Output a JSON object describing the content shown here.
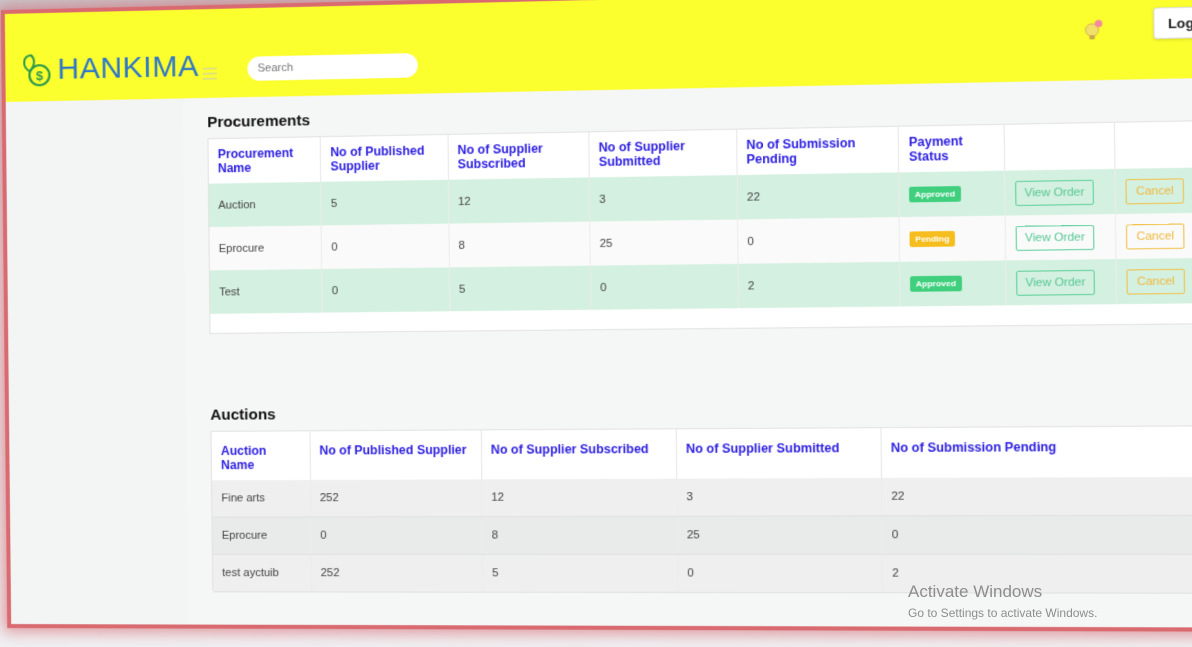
{
  "header": {
    "logo_text": "HANKIMA",
    "search_placeholder": "Search",
    "logout_label": "Log out"
  },
  "procurements": {
    "title": "Procurements",
    "columns": [
      "Procurement Name",
      "No of Published Supplier",
      "No of Supplier Subscribed",
      "No of Supplier Submitted",
      "No of Submission Pending",
      "Payment Status",
      "",
      ""
    ],
    "rows": [
      {
        "name": "Auction",
        "published": "5",
        "subscribed": "12",
        "submitted": "3",
        "pending": "22",
        "status": "Approved",
        "view_label": "View Order",
        "cancel_label": "Cancel"
      },
      {
        "name": "Eprocure",
        "published": "0",
        "subscribed": "8",
        "submitted": "25",
        "pending": "0",
        "status": "Pending",
        "view_label": "View Order",
        "cancel_label": "Cancel"
      },
      {
        "name": "Test",
        "published": "0",
        "subscribed": "5",
        "submitted": "0",
        "pending": "2",
        "status": "Approved",
        "view_label": "View Order",
        "cancel_label": "Cancel"
      }
    ]
  },
  "auctions": {
    "title": "Auctions",
    "columns": [
      "Auction Name",
      "No of Published Supplier",
      "No of Supplier Subscribed",
      "No of Supplier Submitted",
      "No of Submission Pending"
    ],
    "rows": [
      {
        "name": "Fine arts",
        "published": "252",
        "subscribed": "12",
        "submitted": "3",
        "pending": "22"
      },
      {
        "name": "Eprocure",
        "published": "0",
        "subscribed": "8",
        "submitted": "25",
        "pending": "0"
      },
      {
        "name": "test ayctuib",
        "published": "252",
        "subscribed": "5",
        "submitted": "0",
        "pending": "2"
      }
    ]
  },
  "watermark": {
    "line1": "Activate Windows",
    "line2": "Go to Settings to activate Windows."
  },
  "colors": {
    "topbar": "#fbff2e",
    "accent_blue": "#2b1de0",
    "approved": "#3fcf7d",
    "pending": "#f5bd1e",
    "frame_border": "#d86a70"
  }
}
